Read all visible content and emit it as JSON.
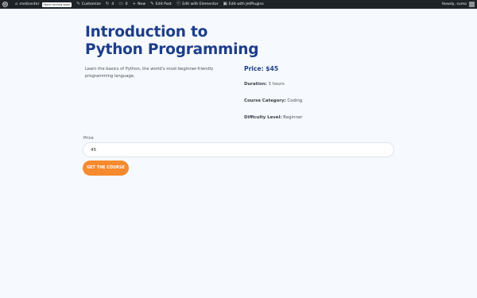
{
  "admin_bar": {
    "site_name": "medcenter",
    "badge": "Store coming soon",
    "customize": "Customize",
    "updates_count": "4",
    "comments_count": "0",
    "new": "New",
    "edit_post": "Edit Post",
    "edit_elementor": "Edit with Elementor",
    "edit_jetplugins": "Edit with JetPlugins",
    "howdy": "Howdy, suma"
  },
  "course": {
    "title": "Introduction to Python Programming",
    "description": "Learn the basics of Python, the world's most beginner-friendly programming language.",
    "price_line": "Price: $45",
    "duration_label": "Duration:",
    "duration_value": "3 hours",
    "category_label": "Course Category:",
    "category_value": "Coding",
    "difficulty_label": "Difficulty Level:",
    "difficulty_value": "Beginner"
  },
  "form": {
    "price_label": "Price",
    "price_value": "45",
    "button_label": "GET THE COURSE"
  },
  "colors": {
    "title": "#1c3d8a",
    "button": "#f58a2f",
    "admin_bar": "#1d2327",
    "page_bg": "#f6f9fd"
  }
}
